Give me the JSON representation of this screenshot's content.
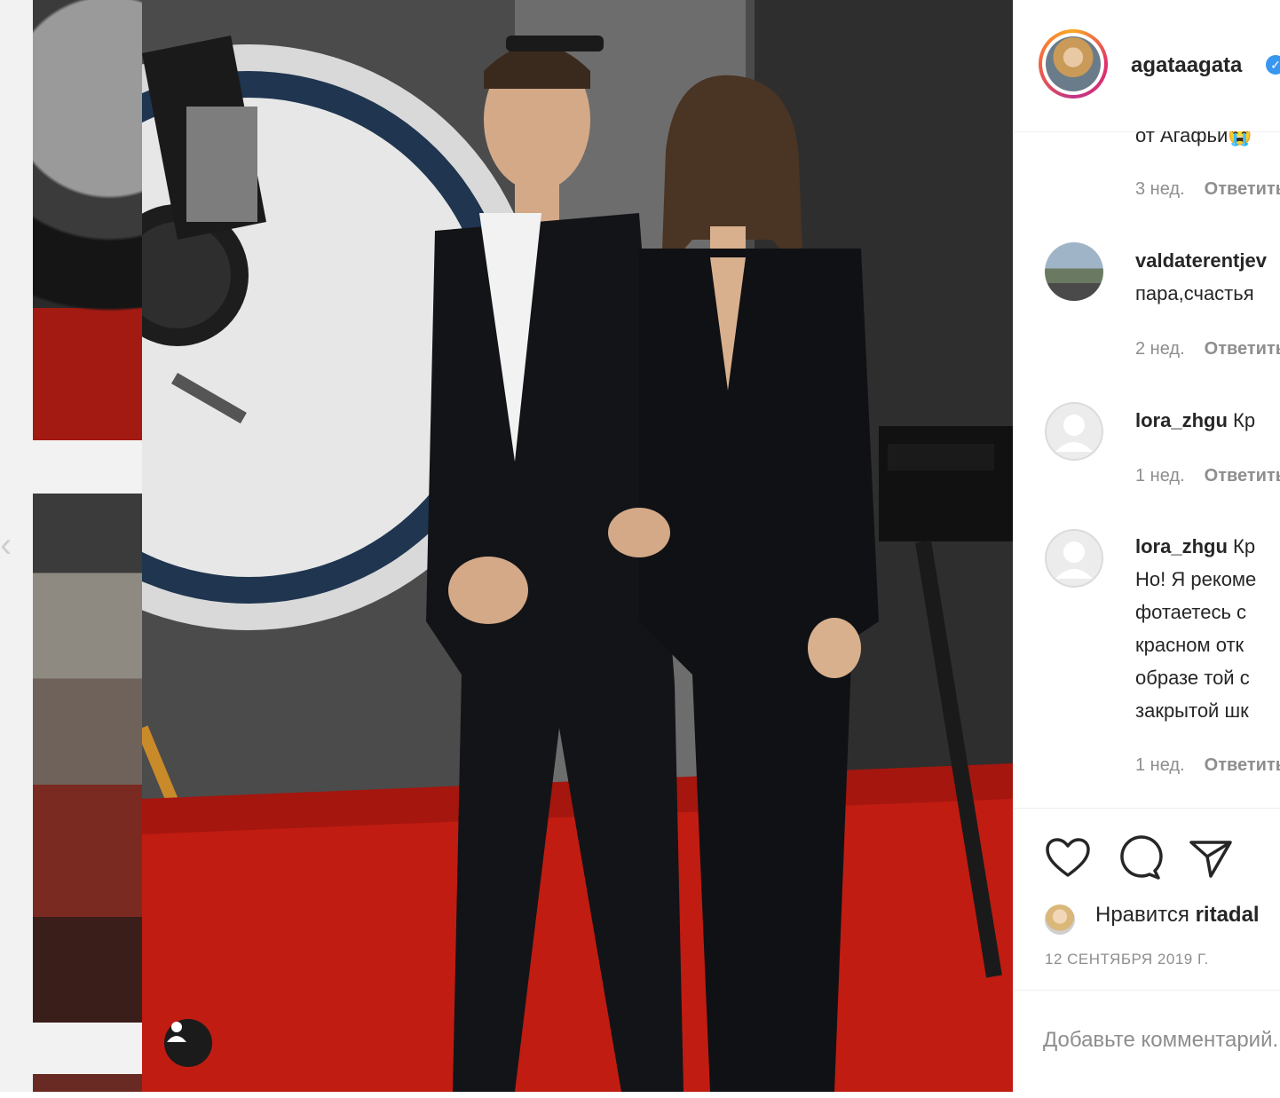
{
  "post": {
    "username": "agataagata",
    "verified_icon": "check-icon"
  },
  "comments": {
    "c0": {
      "text_tail": "от Агафьи😭",
      "time": "3 нед.",
      "reply": "Ответить"
    },
    "c1": {
      "user": "valdaterentjev",
      "text": "пара,счастья",
      "time": "2 нед.",
      "reply": "Ответить"
    },
    "c2": {
      "user": "lora_zhgu",
      "text": "Кр",
      "time": "1 нед.",
      "reply": "Ответить"
    },
    "c3": {
      "user": "lora_zhgu",
      "text": "Кр",
      "lines": [
        "Но! Я рекоме",
        "фотаетесь с",
        "красном отк",
        "образе той с",
        "закрытой шк"
      ],
      "time": "1 нед.",
      "reply": "Ответить"
    }
  },
  "actions": {
    "likes_prefix": "Нравится",
    "likes_user": "ritadal",
    "date": "12 СЕНТЯБРЯ 2019 Г."
  },
  "add_comment": {
    "placeholder": "Добавьте комментарий..."
  },
  "colors": {
    "link_blue": "#3897f0",
    "text": "#262626",
    "muted": "#8e8e8e",
    "carpet_red": "#c01c12"
  }
}
